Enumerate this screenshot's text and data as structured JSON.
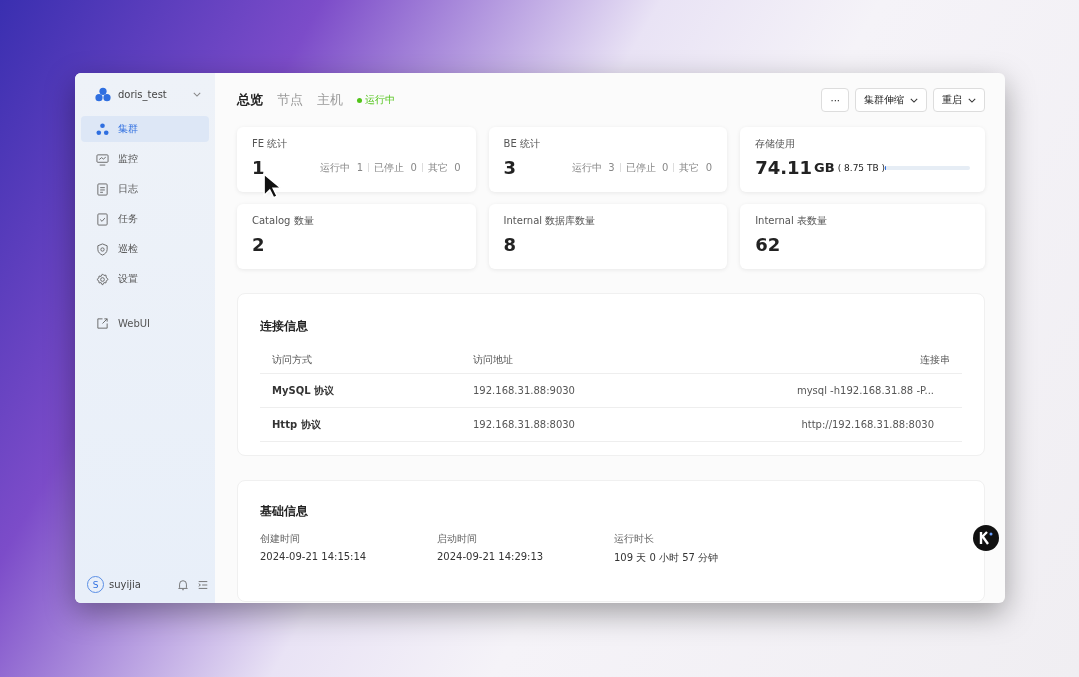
{
  "cluster": {
    "name": "doris_test"
  },
  "sidebar": {
    "items": [
      {
        "label": "集群",
        "selected": true
      },
      {
        "label": "监控",
        "selected": false
      },
      {
        "label": "日志",
        "selected": false
      },
      {
        "label": "任务",
        "selected": false
      },
      {
        "label": "巡检",
        "selected": false
      },
      {
        "label": "设置",
        "selected": false
      }
    ],
    "links": [
      {
        "label": "WebUI"
      }
    ],
    "user": {
      "initial": "S",
      "name": "suyijia"
    }
  },
  "tabs": [
    {
      "label": "总览",
      "selected": true
    },
    {
      "label": "节点",
      "selected": false
    },
    {
      "label": "主机",
      "selected": false
    }
  ],
  "status": {
    "label": "运行中",
    "color": "#52c41a"
  },
  "actions": [
    {
      "label": "···",
      "dropdown": false
    },
    {
      "label": "集群伸缩",
      "dropdown": true
    },
    {
      "label": "重启",
      "dropdown": true
    }
  ],
  "stats": [
    {
      "kind": "count",
      "title": "FE 统计",
      "value": "1",
      "breakdown": [
        {
          "label": "运行中",
          "value": "1"
        },
        {
          "label": "已停止",
          "value": "0"
        },
        {
          "label": "其它",
          "value": "0"
        }
      ]
    },
    {
      "kind": "count",
      "title": "BE 统计",
      "value": "3",
      "breakdown": [
        {
          "label": "运行中",
          "value": "3"
        },
        {
          "label": "已停止",
          "value": "0"
        },
        {
          "label": "其它",
          "value": "0"
        }
      ]
    },
    {
      "kind": "storage",
      "title": "存储使用",
      "value": "74.11",
      "unit": "GB",
      "total": "( 8.75 TB )",
      "level": 0.01
    },
    {
      "kind": "count",
      "title": "Catalog 数量",
      "value": "2"
    },
    {
      "kind": "count",
      "title": "Internal 数据库数量",
      "value": "8"
    },
    {
      "kind": "count",
      "title": "Internal 表数量",
      "value": "62"
    }
  ],
  "connection": {
    "title": "连接信息",
    "columns": [
      "访问方式",
      "访问地址",
      "连接串"
    ],
    "rows": [
      [
        "MySQL 协议",
        "192.168.31.88:9030",
        "mysql -h192.168.31.88 -P..."
      ],
      [
        "Http 协议",
        "192.168.31.88:8030",
        "http://192.168.31.88:8030"
      ]
    ]
  },
  "basic": {
    "title": "基础信息",
    "fields": [
      {
        "label": "创建时间",
        "value": "2024-09-21 14:15:14"
      },
      {
        "label": "启动时间",
        "value": "2024-09-21 14:29:13"
      },
      {
        "label": "运行时长",
        "value": "109 天 0 小时 57 分钟"
      }
    ]
  }
}
